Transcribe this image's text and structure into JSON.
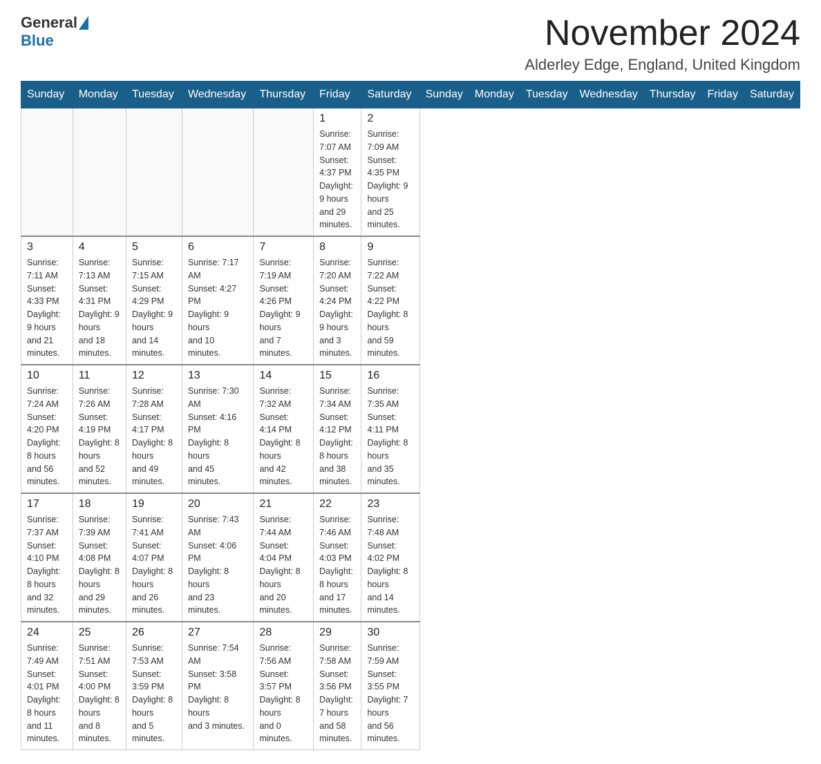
{
  "header": {
    "title": "November 2024",
    "subtitle": "Alderley Edge, England, United Kingdom",
    "logo_general": "General",
    "logo_blue": "Blue"
  },
  "days_of_week": [
    "Sunday",
    "Monday",
    "Tuesday",
    "Wednesday",
    "Thursday",
    "Friday",
    "Saturday"
  ],
  "weeks": [
    [
      {
        "day": "",
        "info": ""
      },
      {
        "day": "",
        "info": ""
      },
      {
        "day": "",
        "info": ""
      },
      {
        "day": "",
        "info": ""
      },
      {
        "day": "",
        "info": ""
      },
      {
        "day": "1",
        "info": "Sunrise: 7:07 AM\nSunset: 4:37 PM\nDaylight: 9 hours\nand 29 minutes."
      },
      {
        "day": "2",
        "info": "Sunrise: 7:09 AM\nSunset: 4:35 PM\nDaylight: 9 hours\nand 25 minutes."
      }
    ],
    [
      {
        "day": "3",
        "info": "Sunrise: 7:11 AM\nSunset: 4:33 PM\nDaylight: 9 hours\nand 21 minutes."
      },
      {
        "day": "4",
        "info": "Sunrise: 7:13 AM\nSunset: 4:31 PM\nDaylight: 9 hours\nand 18 minutes."
      },
      {
        "day": "5",
        "info": "Sunrise: 7:15 AM\nSunset: 4:29 PM\nDaylight: 9 hours\nand 14 minutes."
      },
      {
        "day": "6",
        "info": "Sunrise: 7:17 AM\nSunset: 4:27 PM\nDaylight: 9 hours\nand 10 minutes."
      },
      {
        "day": "7",
        "info": "Sunrise: 7:19 AM\nSunset: 4:26 PM\nDaylight: 9 hours\nand 7 minutes."
      },
      {
        "day": "8",
        "info": "Sunrise: 7:20 AM\nSunset: 4:24 PM\nDaylight: 9 hours\nand 3 minutes."
      },
      {
        "day": "9",
        "info": "Sunrise: 7:22 AM\nSunset: 4:22 PM\nDaylight: 8 hours\nand 59 minutes."
      }
    ],
    [
      {
        "day": "10",
        "info": "Sunrise: 7:24 AM\nSunset: 4:20 PM\nDaylight: 8 hours\nand 56 minutes."
      },
      {
        "day": "11",
        "info": "Sunrise: 7:26 AM\nSunset: 4:19 PM\nDaylight: 8 hours\nand 52 minutes."
      },
      {
        "day": "12",
        "info": "Sunrise: 7:28 AM\nSunset: 4:17 PM\nDaylight: 8 hours\nand 49 minutes."
      },
      {
        "day": "13",
        "info": "Sunrise: 7:30 AM\nSunset: 4:16 PM\nDaylight: 8 hours\nand 45 minutes."
      },
      {
        "day": "14",
        "info": "Sunrise: 7:32 AM\nSunset: 4:14 PM\nDaylight: 8 hours\nand 42 minutes."
      },
      {
        "day": "15",
        "info": "Sunrise: 7:34 AM\nSunset: 4:12 PM\nDaylight: 8 hours\nand 38 minutes."
      },
      {
        "day": "16",
        "info": "Sunrise: 7:35 AM\nSunset: 4:11 PM\nDaylight: 8 hours\nand 35 minutes."
      }
    ],
    [
      {
        "day": "17",
        "info": "Sunrise: 7:37 AM\nSunset: 4:10 PM\nDaylight: 8 hours\nand 32 minutes."
      },
      {
        "day": "18",
        "info": "Sunrise: 7:39 AM\nSunset: 4:08 PM\nDaylight: 8 hours\nand 29 minutes."
      },
      {
        "day": "19",
        "info": "Sunrise: 7:41 AM\nSunset: 4:07 PM\nDaylight: 8 hours\nand 26 minutes."
      },
      {
        "day": "20",
        "info": "Sunrise: 7:43 AM\nSunset: 4:06 PM\nDaylight: 8 hours\nand 23 minutes."
      },
      {
        "day": "21",
        "info": "Sunrise: 7:44 AM\nSunset: 4:04 PM\nDaylight: 8 hours\nand 20 minutes."
      },
      {
        "day": "22",
        "info": "Sunrise: 7:46 AM\nSunset: 4:03 PM\nDaylight: 8 hours\nand 17 minutes."
      },
      {
        "day": "23",
        "info": "Sunrise: 7:48 AM\nSunset: 4:02 PM\nDaylight: 8 hours\nand 14 minutes."
      }
    ],
    [
      {
        "day": "24",
        "info": "Sunrise: 7:49 AM\nSunset: 4:01 PM\nDaylight: 8 hours\nand 11 minutes."
      },
      {
        "day": "25",
        "info": "Sunrise: 7:51 AM\nSunset: 4:00 PM\nDaylight: 8 hours\nand 8 minutes."
      },
      {
        "day": "26",
        "info": "Sunrise: 7:53 AM\nSunset: 3:59 PM\nDaylight: 8 hours\nand 5 minutes."
      },
      {
        "day": "27",
        "info": "Sunrise: 7:54 AM\nSunset: 3:58 PM\nDaylight: 8 hours\nand 3 minutes."
      },
      {
        "day": "28",
        "info": "Sunrise: 7:56 AM\nSunset: 3:57 PM\nDaylight: 8 hours\nand 0 minutes."
      },
      {
        "day": "29",
        "info": "Sunrise: 7:58 AM\nSunset: 3:56 PM\nDaylight: 7 hours\nand 58 minutes."
      },
      {
        "day": "30",
        "info": "Sunrise: 7:59 AM\nSunset: 3:55 PM\nDaylight: 7 hours\nand 56 minutes."
      }
    ]
  ]
}
